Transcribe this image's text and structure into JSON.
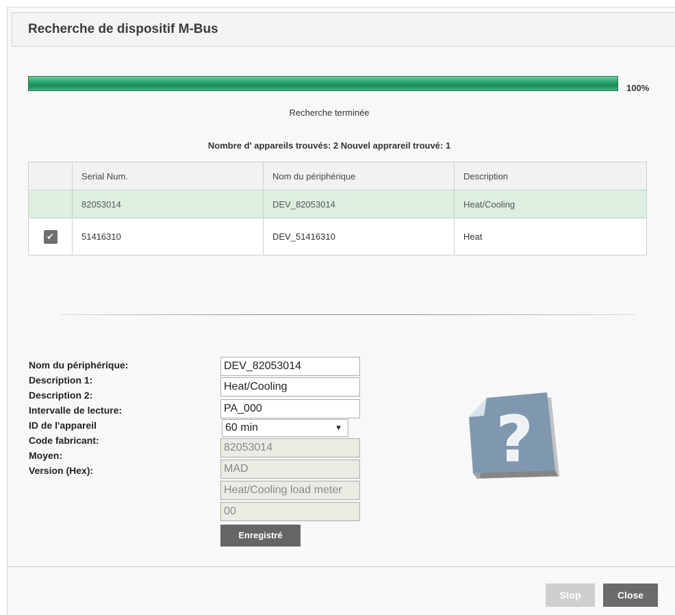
{
  "dialog": {
    "title": "Recherche de dispositif M-Bus"
  },
  "progress": {
    "percent_label": "100%",
    "fraction": 1.0,
    "status": "Recherche terminée",
    "count_text": "Nombre d' appareils trouvés: 2 Nouvel apprareil trouvé: 1"
  },
  "table": {
    "headers": [
      "Serial Num.",
      "Nom du périphérique",
      "Description"
    ],
    "rows": [
      {
        "serial": "82053014",
        "name": "DEV_82053014",
        "description": "Heat/Cooling",
        "checked": false
      },
      {
        "serial": "51416310",
        "name": "DEV_51416310",
        "description": "Heat",
        "checked": true
      }
    ]
  },
  "form": {
    "labels": {
      "device_name": "Nom du périphérique:",
      "description1": "Description 1:",
      "description2": "Description 2:",
      "interval": "Intervalle de lecture:",
      "device_id": "ID de l'appareil",
      "manufacturer": "Code fabricant:",
      "medium": "Moyen:",
      "version": "Version (Hex):"
    },
    "values": {
      "device_name": "DEV_82053014",
      "description1": "Heat/Cooling",
      "description2": "PA_000",
      "interval": "60 min",
      "device_id": "82053014",
      "manufacturer": "MAD",
      "medium": "Heat/Cooling load meter",
      "version": "00"
    },
    "save_label": "Enregistré"
  },
  "footer": {
    "stop_label": "Stop",
    "close_label": "Close"
  },
  "colors": {
    "progress_green": "#1b8a58",
    "new_row_bg": "#dcefe0",
    "button_dark": "#656565",
    "button_disabled": "#cfcfcf"
  },
  "icons": {
    "unknown_device": "question-mark-document-icon",
    "check": "check-icon",
    "select_arrow": "triangle-down-icon"
  }
}
